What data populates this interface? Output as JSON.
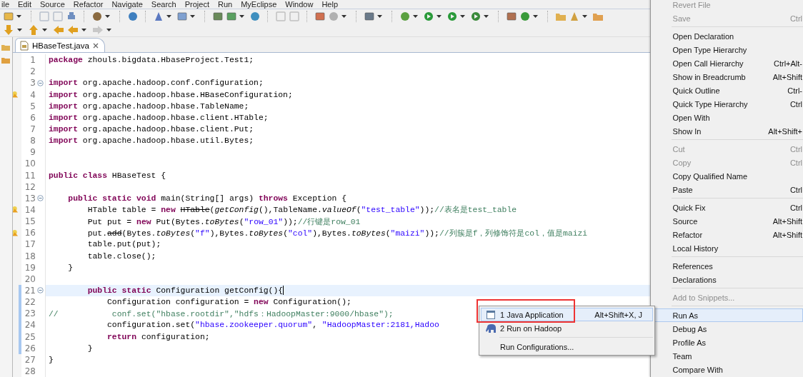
{
  "menu_bar": [
    "ile",
    "Edit",
    "Source",
    "Refactor",
    "Navigate",
    "Search",
    "Project",
    "Run",
    "MyEclipse",
    "Window",
    "Help"
  ],
  "editor": {
    "tab": {
      "title": "HBaseTest.java",
      "selected": true
    },
    "lines": [
      {
        "number": "1",
        "fold": false,
        "warning": false,
        "current": false,
        "changed": false,
        "segments": [
          {
            "text": "package",
            "kind": "kw"
          },
          {
            "text": " zhouls.bigdata.HbaseProject.Test1;",
            "kind": "plain"
          }
        ]
      },
      {
        "number": "2",
        "fold": false,
        "warning": false,
        "current": false,
        "changed": false
      },
      {
        "number": "3",
        "fold": true,
        "warning": false,
        "current": false,
        "changed": false,
        "segments": [
          {
            "text": "import",
            "kind": "kw"
          },
          {
            "text": " org.apache.hadoop.conf.Configuration;",
            "kind": "plain"
          }
        ]
      },
      {
        "number": "4",
        "fold": false,
        "warning": true,
        "current": false,
        "changed": false,
        "segments": [
          {
            "text": "import",
            "kind": "kw"
          },
          {
            "text": " org.apache.hadoop.hbase.HBaseConfiguration;",
            "kind": "plain"
          }
        ]
      },
      {
        "number": "5",
        "fold": false,
        "warning": false,
        "current": false,
        "changed": false,
        "segments": [
          {
            "text": "import",
            "kind": "kw"
          },
          {
            "text": " org.apache.hadoop.hbase.TableName;",
            "kind": "plain"
          }
        ]
      },
      {
        "number": "6",
        "fold": false,
        "warning": false,
        "current": false,
        "changed": false,
        "segments": [
          {
            "text": "import",
            "kind": "kw"
          },
          {
            "text": " org.apache.hadoop.hbase.client.HTable;",
            "kind": "plain"
          }
        ]
      },
      {
        "number": "7",
        "fold": false,
        "warning": false,
        "current": false,
        "changed": false,
        "segments": [
          {
            "text": "import",
            "kind": "kw"
          },
          {
            "text": " org.apache.hadoop.hbase.client.Put;",
            "kind": "plain"
          }
        ]
      },
      {
        "number": "8",
        "fold": false,
        "warning": false,
        "current": false,
        "changed": false,
        "segments": [
          {
            "text": "import",
            "kind": "kw"
          },
          {
            "text": " org.apache.hadoop.hbase.util.Bytes;",
            "kind": "plain"
          }
        ]
      },
      {
        "number": "9",
        "fold": false,
        "warning": false,
        "current": false,
        "changed": false
      },
      {
        "number": "10",
        "fold": false,
        "warning": false,
        "current": false,
        "changed": false
      },
      {
        "number": "11",
        "fold": false,
        "warning": false,
        "current": false,
        "changed": false,
        "segments": [
          {
            "text": "public class",
            "kind": "kw"
          },
          {
            "text": " HBaseTest {",
            "kind": "plain"
          }
        ]
      },
      {
        "number": "12",
        "fold": false,
        "warning": false,
        "current": false,
        "changed": false
      },
      {
        "number": "13",
        "fold": true,
        "warning": false,
        "current": false,
        "changed": false,
        "segments": [
          {
            "text": "    public static void",
            "kind": "kw"
          },
          {
            "text": " main(String[] args) ",
            "kind": "plain"
          },
          {
            "text": "throws",
            "kind": "kw"
          },
          {
            "text": " Exception {",
            "kind": "plain"
          }
        ]
      },
      {
        "number": "14",
        "fold": false,
        "warning": true,
        "current": false,
        "changed": false,
        "segments": [
          {
            "text": "        HTable table = ",
            "kind": "plain"
          },
          {
            "text": "new ",
            "kind": "kw"
          },
          {
            "text": "HTable",
            "kind": "deprecated"
          },
          {
            "text": "(",
            "kind": "plain"
          },
          {
            "text": "getConfig",
            "kind": "italic"
          },
          {
            "text": "(),TableName.",
            "kind": "plain"
          },
          {
            "text": "valueOf",
            "kind": "italic"
          },
          {
            "text": "(",
            "kind": "plain"
          },
          {
            "text": "\"test_table\"",
            "kind": "str"
          },
          {
            "text": "));",
            "kind": "plain"
          },
          {
            "text": "//表名是test_table",
            "kind": "cmt"
          }
        ]
      },
      {
        "number": "15",
        "fold": false,
        "warning": false,
        "current": false,
        "changed": false,
        "segments": [
          {
            "text": "        Put put = ",
            "kind": "plain"
          },
          {
            "text": "new",
            "kind": "kw"
          },
          {
            "text": " Put(Bytes.",
            "kind": "plain"
          },
          {
            "text": "toBytes",
            "kind": "italic"
          },
          {
            "text": "(",
            "kind": "plain"
          },
          {
            "text": "\"row_01\"",
            "kind": "str"
          },
          {
            "text": "));",
            "kind": "plain"
          },
          {
            "text": "//行键是row_01",
            "kind": "cmt"
          }
        ]
      },
      {
        "number": "16",
        "fold": false,
        "warning": true,
        "current": false,
        "changed": false,
        "segments": [
          {
            "text": "        put.",
            "kind": "plain"
          },
          {
            "text": "add",
            "kind": "deprecated"
          },
          {
            "text": "(Bytes.",
            "kind": "plain"
          },
          {
            "text": "toBytes",
            "kind": "italic"
          },
          {
            "text": "(",
            "kind": "plain"
          },
          {
            "text": "\"f\"",
            "kind": "str"
          },
          {
            "text": "),Bytes.",
            "kind": "plain"
          },
          {
            "text": "toBytes",
            "kind": "italic"
          },
          {
            "text": "(",
            "kind": "plain"
          },
          {
            "text": "\"col\"",
            "kind": "str"
          },
          {
            "text": "),Bytes.",
            "kind": "plain"
          },
          {
            "text": "toBytes",
            "kind": "italic"
          },
          {
            "text": "(",
            "kind": "plain"
          },
          {
            "text": "\"maizi\"",
            "kind": "str"
          },
          {
            "text": "));",
            "kind": "plain"
          },
          {
            "text": "//列簇是f，列修饰符是col，值是maizi",
            "kind": "cmt"
          }
        ]
      },
      {
        "number": "17",
        "fold": false,
        "warning": false,
        "current": false,
        "changed": false,
        "segments": [
          {
            "text": "        table.put(put);",
            "kind": "plain"
          }
        ]
      },
      {
        "number": "18",
        "fold": false,
        "warning": false,
        "current": false,
        "changed": false,
        "segments": [
          {
            "text": "        table.close();",
            "kind": "plain"
          }
        ]
      },
      {
        "number": "19",
        "fold": false,
        "warning": false,
        "current": false,
        "changed": false,
        "segments": [
          {
            "text": "    }",
            "kind": "plain"
          }
        ]
      },
      {
        "number": "20",
        "fold": false,
        "warning": false,
        "current": false,
        "changed": false
      },
      {
        "number": "21",
        "fold": true,
        "warning": false,
        "current": true,
        "changed": true,
        "segments": [
          {
            "text": "        public static",
            "kind": "kw"
          },
          {
            "text": " Configuration getConfig(){",
            "kind": "plain"
          }
        ]
      },
      {
        "number": "22",
        "fold": false,
        "warning": false,
        "current": false,
        "changed": true,
        "segments": [
          {
            "text": "            Configuration configuration = ",
            "kind": "plain"
          },
          {
            "text": "new",
            "kind": "kw"
          },
          {
            "text": " Configuration();",
            "kind": "plain"
          }
        ]
      },
      {
        "number": "23",
        "fold": false,
        "warning": false,
        "current": false,
        "changed": true,
        "segments": [
          {
            "text": "//           conf.set(\"hbase.rootdir\",\"hdfs：HadoopMaster:9000/hbase\");",
            "kind": "cmt"
          }
        ]
      },
      {
        "number": "24",
        "fold": false,
        "warning": false,
        "current": false,
        "changed": true,
        "segments": [
          {
            "text": "            configuration.set(",
            "kind": "plain"
          },
          {
            "text": "\"hbase.zookeeper.quorum\"",
            "kind": "str"
          },
          {
            "text": ", ",
            "kind": "plain"
          },
          {
            "text": "\"HadoopMaster:2181,Hadoo",
            "kind": "str"
          }
        ]
      },
      {
        "number": "25",
        "fold": false,
        "warning": false,
        "current": false,
        "changed": true,
        "segments": [
          {
            "text": "            return",
            "kind": "kw"
          },
          {
            "text": " configuration;",
            "kind": "plain"
          }
        ]
      },
      {
        "number": "26",
        "fold": false,
        "warning": false,
        "current": false,
        "changed": true,
        "segments": [
          {
            "text": "        }",
            "kind": "plain"
          }
        ]
      },
      {
        "number": "27",
        "fold": false,
        "warning": false,
        "current": false,
        "changed": false,
        "segments": [
          {
            "text": "}",
            "kind": "plain"
          }
        ]
      },
      {
        "number": "28",
        "fold": false,
        "warning": false,
        "current": false,
        "changed": false
      }
    ]
  },
  "context_menu": {
    "items": [
      {
        "kind": "item",
        "label": "Revert File",
        "disabled": true,
        "selected": false
      },
      {
        "kind": "item",
        "label": "Save",
        "shortcut": "Ctrl",
        "disabled": true,
        "selected": false
      },
      {
        "kind": "separator"
      },
      {
        "kind": "item",
        "label": "Open Declaration",
        "disabled": false,
        "selected": false
      },
      {
        "kind": "item",
        "label": "Open Type Hierarchy",
        "disabled": false,
        "selected": false
      },
      {
        "kind": "item",
        "label": "Open Call Hierarchy",
        "shortcut": "Ctrl+Alt-",
        "disabled": false,
        "selected": false
      },
      {
        "kind": "item",
        "label": "Show in Breadcrumb",
        "shortcut": "Alt+Shift",
        "disabled": false,
        "selected": false
      },
      {
        "kind": "item",
        "label": "Quick Outline",
        "shortcut": "Ctrl-",
        "disabled": false,
        "selected": false
      },
      {
        "kind": "item",
        "label": "Quick Type Hierarchy",
        "shortcut": "Ctrl",
        "disabled": false,
        "selected": false
      },
      {
        "kind": "item",
        "label": "Open With",
        "disabled": false,
        "selected": false
      },
      {
        "kind": "item",
        "label": "Show In",
        "shortcut": "Alt+Shift+",
        "disabled": false,
        "selected": false
      },
      {
        "kind": "separator"
      },
      {
        "kind": "item",
        "label": "Cut",
        "shortcut": "Ctrl",
        "disabled": true,
        "selected": false
      },
      {
        "kind": "item",
        "label": "Copy",
        "shortcut": "Ctrl",
        "disabled": true,
        "selected": false
      },
      {
        "kind": "item",
        "label": "Copy Qualified Name",
        "disabled": false,
        "selected": false
      },
      {
        "kind": "item",
        "label": "Paste",
        "shortcut": "Ctrl",
        "disabled": false,
        "selected": false
      },
      {
        "kind": "separator"
      },
      {
        "kind": "item",
        "label": "Quick Fix",
        "shortcut": "Ctrl",
        "disabled": false,
        "selected": false
      },
      {
        "kind": "item",
        "label": "Source",
        "shortcut": "Alt+Shift",
        "disabled": false,
        "selected": false
      },
      {
        "kind": "item",
        "label": "Refactor",
        "shortcut": "Alt+Shift",
        "disabled": false,
        "selected": false
      },
      {
        "kind": "item",
        "label": "Local History",
        "disabled": false,
        "selected": false
      },
      {
        "kind": "separator"
      },
      {
        "kind": "item",
        "label": "References",
        "disabled": false,
        "selected": false
      },
      {
        "kind": "item",
        "label": "Declarations",
        "disabled": false,
        "selected": false
      },
      {
        "kind": "separator"
      },
      {
        "kind": "item",
        "label": "Add to Snippets...",
        "disabled": true,
        "selected": false
      },
      {
        "kind": "separator"
      },
      {
        "kind": "item",
        "label": "Run As",
        "disabled": false,
        "selected": true
      },
      {
        "kind": "item",
        "label": "Debug As",
        "disabled": false,
        "selected": false
      },
      {
        "kind": "item",
        "label": "Profile As",
        "disabled": false,
        "selected": false
      },
      {
        "kind": "item",
        "label": "Team",
        "disabled": false,
        "selected": false
      },
      {
        "kind": "item",
        "label": "Compare With",
        "disabled": false,
        "selected": false
      }
    ]
  },
  "submenu": {
    "items": [
      {
        "kind": "item",
        "label": "1 Java Application",
        "shortcut": "Alt+Shift+X, J",
        "selected": true
      },
      {
        "kind": "item",
        "label": "2 Run on Hadoop",
        "selected": false
      },
      {
        "kind": "separator"
      },
      {
        "kind": "item",
        "label": "Run Configurations...",
        "selected": false
      }
    ]
  }
}
